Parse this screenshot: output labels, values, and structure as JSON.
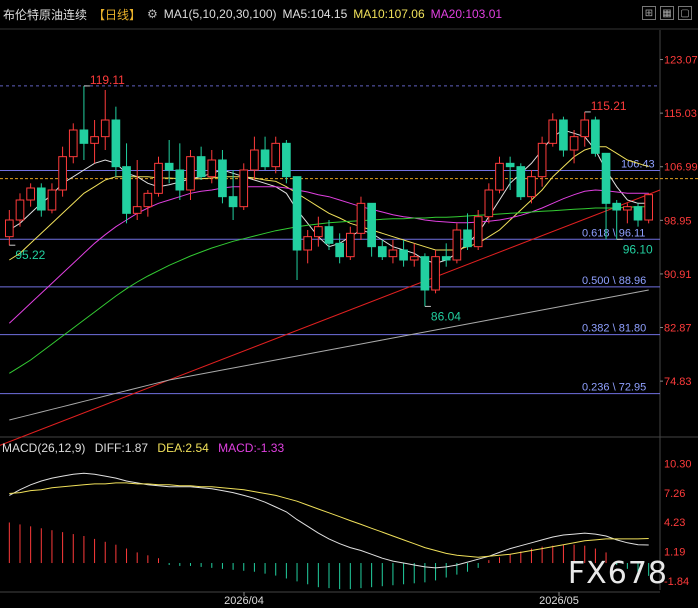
{
  "header": {
    "instrument": "布伦特原油连续",
    "period": "【日线】",
    "settings_icon": "gear-icon",
    "ma_params": "MA1(5,10,20,30,100)",
    "ma5": "MA5:104.15",
    "ma10": "MA10:107.06",
    "ma20": "MA20:103.01"
  },
  "corner_icons": [
    "crosshair-icon",
    "grid-icon",
    "window-icon"
  ],
  "macd_header": {
    "params": "MACD(26,12,9)",
    "diff": "DIFF:1.87",
    "dea": "DEA:2.54",
    "macd": "MACD:-1.33"
  },
  "watermark": "FX678",
  "colors": {
    "up": "#ff3b3b",
    "down": "#22d0a0",
    "ma5": "#e0e0e0",
    "ma10": "#f0e05a",
    "ma20": "#e040e0",
    "ma30": "#33cc33",
    "ma100": "#aaaaaa",
    "fib_line": "#7070e0",
    "dashed_yellow": "#e0a020",
    "trend": "#e02020"
  },
  "chart_data": [
    {
      "type": "candlestick",
      "title": "布伦特原油连续 日线",
      "y_ticks": [
        "123.07",
        "115.03",
        "106.99",
        "98.95",
        "90.91",
        "82.87",
        "74.83"
      ],
      "x_ticks": [
        "2026/04",
        "2026/05"
      ],
      "last_price": 105.2,
      "ylim": [
        67.5,
        127.5
      ],
      "candles": [
        [
          96.5,
          100.5,
          95.2,
          99.0
        ],
        [
          99.0,
          103.0,
          98.0,
          102.0
        ],
        [
          102.0,
          104.5,
          101.0,
          103.8
        ],
        [
          103.8,
          104.5,
          99.5,
          100.5
        ],
        [
          100.5,
          104.5,
          100.0,
          103.5
        ],
        [
          103.5,
          110.0,
          102.5,
          108.5
        ],
        [
          108.5,
          113.5,
          107.5,
          112.5
        ],
        [
          112.5,
          119.11,
          108.0,
          110.5
        ],
        [
          110.5,
          114.0,
          107.5,
          111.5
        ],
        [
          111.5,
          118.5,
          109.5,
          114.0
        ],
        [
          114.0,
          116.0,
          105.5,
          107.0
        ],
        [
          107.0,
          110.5,
          98.5,
          100.0
        ],
        [
          100.0,
          108.0,
          99.0,
          101.0
        ],
        [
          101.0,
          103.5,
          99.5,
          103.0
        ],
        [
          103.0,
          108.5,
          102.5,
          107.5
        ],
        [
          107.5,
          111.0,
          104.5,
          106.5
        ],
        [
          106.5,
          110.5,
          102.0,
          103.5
        ],
        [
          103.5,
          109.5,
          102.0,
          108.5
        ],
        [
          108.5,
          110.0,
          105.0,
          105.5
        ],
        [
          105.5,
          109.5,
          104.5,
          108.0
        ],
        [
          108.0,
          109.5,
          101.5,
          102.5
        ],
        [
          102.5,
          106.5,
          99.0,
          101.0
        ],
        [
          101.0,
          107.5,
          100.5,
          106.5
        ],
        [
          106.5,
          111.5,
          105.0,
          109.5
        ],
        [
          109.5,
          111.5,
          106.5,
          107.0
        ],
        [
          107.0,
          111.5,
          106.0,
          110.5
        ],
        [
          110.5,
          111.0,
          104.5,
          105.5
        ],
        [
          105.5,
          105.5,
          90.0,
          94.5
        ],
        [
          94.5,
          97.5,
          92.5,
          96.5
        ],
        [
          96.5,
          99.5,
          95.0,
          98.0
        ],
        [
          98.0,
          99.0,
          94.5,
          95.5
        ],
        [
          95.5,
          97.0,
          92.5,
          93.5
        ],
        [
          93.5,
          98.0,
          93.0,
          97.0
        ],
        [
          97.0,
          102.5,
          96.0,
          101.5
        ],
        [
          101.5,
          101.5,
          93.5,
          95.0
        ],
        [
          95.0,
          96.0,
          93.0,
          93.5
        ],
        [
          93.5,
          96.0,
          92.5,
          94.5
        ],
        [
          94.5,
          96.0,
          92.0,
          93.0
        ],
        [
          93.0,
          95.5,
          92.0,
          93.5
        ],
        [
          93.5,
          94.0,
          86.04,
          88.5
        ],
        [
          88.5,
          94.5,
          88.0,
          93.5
        ],
        [
          93.5,
          95.5,
          92.0,
          93.0
        ],
        [
          93.0,
          98.5,
          92.5,
          97.5
        ],
        [
          97.5,
          100.0,
          94.5,
          95.0
        ],
        [
          95.0,
          100.5,
          94.5,
          99.5
        ],
        [
          99.5,
          104.5,
          98.5,
          103.5
        ],
        [
          103.5,
          108.5,
          103.0,
          107.5
        ],
        [
          107.5,
          108.5,
          103.5,
          107.0
        ],
        [
          107.0,
          107.5,
          102.0,
          102.5
        ],
        [
          102.5,
          106.5,
          101.5,
          105.5
        ],
        [
          105.5,
          111.5,
          104.0,
          110.5
        ],
        [
          110.5,
          115.0,
          110.0,
          114.0
        ],
        [
          114.0,
          114.5,
          108.5,
          109.5
        ],
        [
          109.5,
          112.5,
          107.5,
          111.5
        ],
        [
          111.5,
          115.21,
          110.0,
          114.0
        ],
        [
          114.0,
          114.5,
          108.5,
          109.0
        ],
        [
          109.0,
          109.0,
          96.1,
          101.5
        ],
        [
          101.5,
          102.0,
          96.1,
          100.5
        ],
        [
          100.5,
          101.5,
          98.5,
          101.0
        ],
        [
          101.0,
          101.5,
          98.0,
          99.0
        ],
        [
          99.0,
          103.0,
          98.5,
          102.8
        ]
      ],
      "series": [
        {
          "name": "MA5",
          "values": [
            97.5,
            98.5,
            100.0,
            101.5,
            102.8,
            104.5,
            105.5,
            106.5,
            107.5,
            108.0,
            107.5,
            106.0,
            105.5,
            104.5,
            104.0,
            104.3,
            104.7,
            105.2,
            105.5,
            106.0,
            106.5,
            106.0,
            105.5,
            105.0,
            104.5,
            104.0,
            103.0,
            100.5,
            98.5,
            96.5,
            95.0,
            95.5,
            96.5,
            97.5,
            97.0,
            96.0,
            95.0,
            94.5,
            94.0,
            93.0,
            92.5,
            93.0,
            94.0,
            95.5,
            97.0,
            99.5,
            102.0,
            104.5,
            106.0,
            107.5,
            109.5,
            111.5,
            112.5,
            112.0,
            111.5,
            109.5,
            106.5,
            104.0,
            102.0,
            101.5,
            101.5
          ]
        },
        {
          "name": "MA10",
          "values": [
            93.0,
            94.0,
            95.5,
            97.0,
            98.5,
            100.0,
            101.5,
            103.0,
            104.0,
            105.0,
            105.5,
            105.5,
            105.5,
            105.5,
            105.3,
            105.3,
            105.2,
            105.2,
            105.2,
            105.3,
            105.5,
            105.5,
            105.5,
            105.3,
            105.0,
            104.8,
            104.0,
            103.0,
            102.0,
            101.0,
            100.0,
            99.3,
            98.5,
            98.0,
            97.5,
            97.0,
            96.5,
            96.0,
            95.5,
            95.0,
            94.5,
            94.5,
            94.5,
            95.0,
            95.5,
            96.5,
            97.5,
            99.0,
            100.5,
            102.0,
            103.5,
            105.5,
            107.0,
            108.5,
            109.5,
            110.0,
            110.0,
            109.0,
            108.0,
            107.5,
            107.0
          ]
        },
        {
          "name": "MA20",
          "values": [
            83.5,
            85.0,
            86.5,
            88.0,
            89.5,
            91.0,
            92.5,
            94.0,
            95.5,
            96.8,
            98.0,
            99.0,
            100.0,
            100.8,
            101.5,
            102.0,
            102.5,
            103.0,
            103.3,
            103.5,
            103.8,
            104.0,
            104.0,
            104.0,
            104.0,
            104.0,
            103.8,
            103.5,
            103.2,
            102.8,
            102.5,
            102.0,
            101.5,
            101.0,
            100.6,
            100.2,
            99.8,
            99.5,
            99.3,
            99.0,
            98.8,
            98.7,
            98.6,
            98.6,
            98.7,
            98.8,
            99.0,
            99.3,
            99.7,
            100.2,
            100.8,
            101.5,
            102.2,
            102.8,
            103.3,
            103.5,
            103.4,
            103.2,
            103.0,
            103.0,
            103.01
          ]
        },
        {
          "name": "MA30",
          "values": [
            76.0,
            77.0,
            78.0,
            79.2,
            80.4,
            81.6,
            82.8,
            84.0,
            85.2,
            86.4,
            87.6,
            88.7,
            89.7,
            90.6,
            91.4,
            92.2,
            92.9,
            93.6,
            94.2,
            94.8,
            95.3,
            95.8,
            96.2,
            96.6,
            97.0,
            97.4,
            97.7,
            98.0,
            98.2,
            98.4,
            98.6,
            98.7,
            98.8,
            98.9,
            99.0,
            99.1,
            99.2,
            99.2,
            99.3,
            99.3,
            99.4,
            99.4,
            99.5,
            99.6,
            99.7,
            99.8,
            99.9,
            100.0,
            100.1,
            100.2,
            100.3,
            100.4,
            100.5,
            100.6,
            100.7,
            100.8,
            100.8,
            100.8,
            100.9,
            101.0,
            101.0
          ]
        },
        {
          "name": "MA100",
          "values": [
            69.0,
            69.4,
            69.8,
            70.2,
            70.6,
            71.0,
            71.4,
            71.8,
            72.2,
            72.6,
            73.0,
            73.4,
            73.8,
            74.2,
            74.6,
            75.0,
            75.3,
            75.6,
            75.9,
            76.2,
            76.5,
            76.8,
            77.1,
            77.4,
            77.7,
            78.0,
            78.3,
            78.6,
            78.9,
            79.2,
            79.5,
            79.8,
            80.1,
            80.4,
            80.7,
            81.0,
            81.3,
            81.6,
            81.9,
            82.2,
            82.5,
            82.8,
            83.1,
            83.4,
            83.7,
            84.0,
            84.3,
            84.6,
            84.9,
            85.2,
            85.5,
            85.8,
            86.1,
            86.4,
            86.7,
            87.0,
            87.3,
            87.6,
            87.9,
            88.2,
            88.5
          ]
        }
      ],
      "annotations": [
        {
          "label": "119.11",
          "value": 119.11,
          "index": 7,
          "color": "#ff3b3b"
        },
        {
          "label": "95.22",
          "value": 95.22,
          "index": 0,
          "color": "#22d0a0"
        },
        {
          "label": "86.04",
          "value": 86.04,
          "index": 39,
          "color": "#22d0a0"
        },
        {
          "label": "115.21",
          "value": 115.21,
          "index": 54,
          "color": "#ff3b3b"
        },
        {
          "label": "96.10",
          "value": 96.1,
          "index": 57,
          "color": "#22d0a0"
        }
      ],
      "fib_levels": [
        {
          "label": "106.43",
          "value": 106.43
        },
        {
          "label": "0.618 \\ 96.11",
          "value": 96.11
        },
        {
          "label": "0.500 \\ 88.96",
          "value": 88.96
        },
        {
          "label": "0.382 \\ 81.80",
          "value": 81.8
        },
        {
          "label": "0.236 \\ 72.95",
          "value": 72.95
        }
      ],
      "hline_dashed": 105.2,
      "trendline": [
        [
          0,
          66.0
        ],
        [
          60,
          103.5
        ]
      ]
    },
    {
      "type": "macd",
      "y_ticks": [
        "10.30",
        "7.26",
        "4.23",
        "1.19",
        "-1.84"
      ],
      "ylim": [
        -3.0,
        11.5
      ],
      "diff": [
        7.0,
        7.6,
        8.1,
        8.5,
        8.8,
        9.0,
        9.2,
        9.3,
        9.2,
        9.0,
        8.8,
        8.5,
        8.3,
        8.1,
        8.0,
        7.9,
        7.9,
        7.9,
        7.8,
        7.7,
        7.5,
        7.3,
        7.0,
        6.7,
        6.3,
        5.8,
        5.3,
        4.5,
        3.8,
        3.1,
        2.5,
        2.0,
        1.6,
        1.3,
        0.9,
        0.5,
        0.2,
        0.0,
        -0.2,
        -0.4,
        -0.5,
        -0.4,
        -0.2,
        0.1,
        0.4,
        0.7,
        1.1,
        1.5,
        1.8,
        2.1,
        2.4,
        2.7,
        2.9,
        3.0,
        3.1,
        3.0,
        2.8,
        2.4,
        2.1,
        1.9,
        1.87
      ],
      "dea": [
        7.2,
        7.3,
        7.5,
        7.6,
        7.8,
        7.9,
        8.0,
        8.1,
        8.2,
        8.2,
        8.3,
        8.3,
        8.2,
        8.2,
        8.1,
        8.1,
        8.0,
        8.0,
        7.9,
        7.9,
        7.8,
        7.7,
        7.6,
        7.4,
        7.2,
        7.0,
        6.7,
        6.4,
        6.0,
        5.6,
        5.2,
        4.8,
        4.4,
        4.0,
        3.6,
        3.2,
        2.8,
        2.4,
        2.0,
        1.6,
        1.3,
        1.0,
        0.8,
        0.7,
        0.6,
        0.7,
        0.8,
        0.9,
        1.1,
        1.3,
        1.5,
        1.7,
        1.9,
        2.1,
        2.3,
        2.4,
        2.5,
        2.5,
        2.5,
        2.5,
        2.54
      ],
      "histogram": [
        4.2,
        4.0,
        3.8,
        3.6,
        3.4,
        3.2,
        3.0,
        2.8,
        2.5,
        2.2,
        1.9,
        1.5,
        1.1,
        0.8,
        0.5,
        -0.2,
        -0.3,
        -0.3,
        -0.4,
        -0.5,
        -0.6,
        -0.7,
        -0.8,
        -0.9,
        -1.1,
        -1.3,
        -1.6,
        -1.9,
        -2.2,
        -2.5,
        -2.6,
        -2.7,
        -2.7,
        -2.6,
        -2.5,
        -2.4,
        -2.3,
        -2.2,
        -2.1,
        -2.0,
        -1.8,
        -1.5,
        -1.2,
        -0.9,
        -0.5,
        0.3,
        0.6,
        0.9,
        1.2,
        1.5,
        1.7,
        1.8,
        1.9,
        1.9,
        1.8,
        1.5,
        1.1,
        -0.2,
        -0.6,
        -1.0,
        -1.33
      ]
    }
  ]
}
